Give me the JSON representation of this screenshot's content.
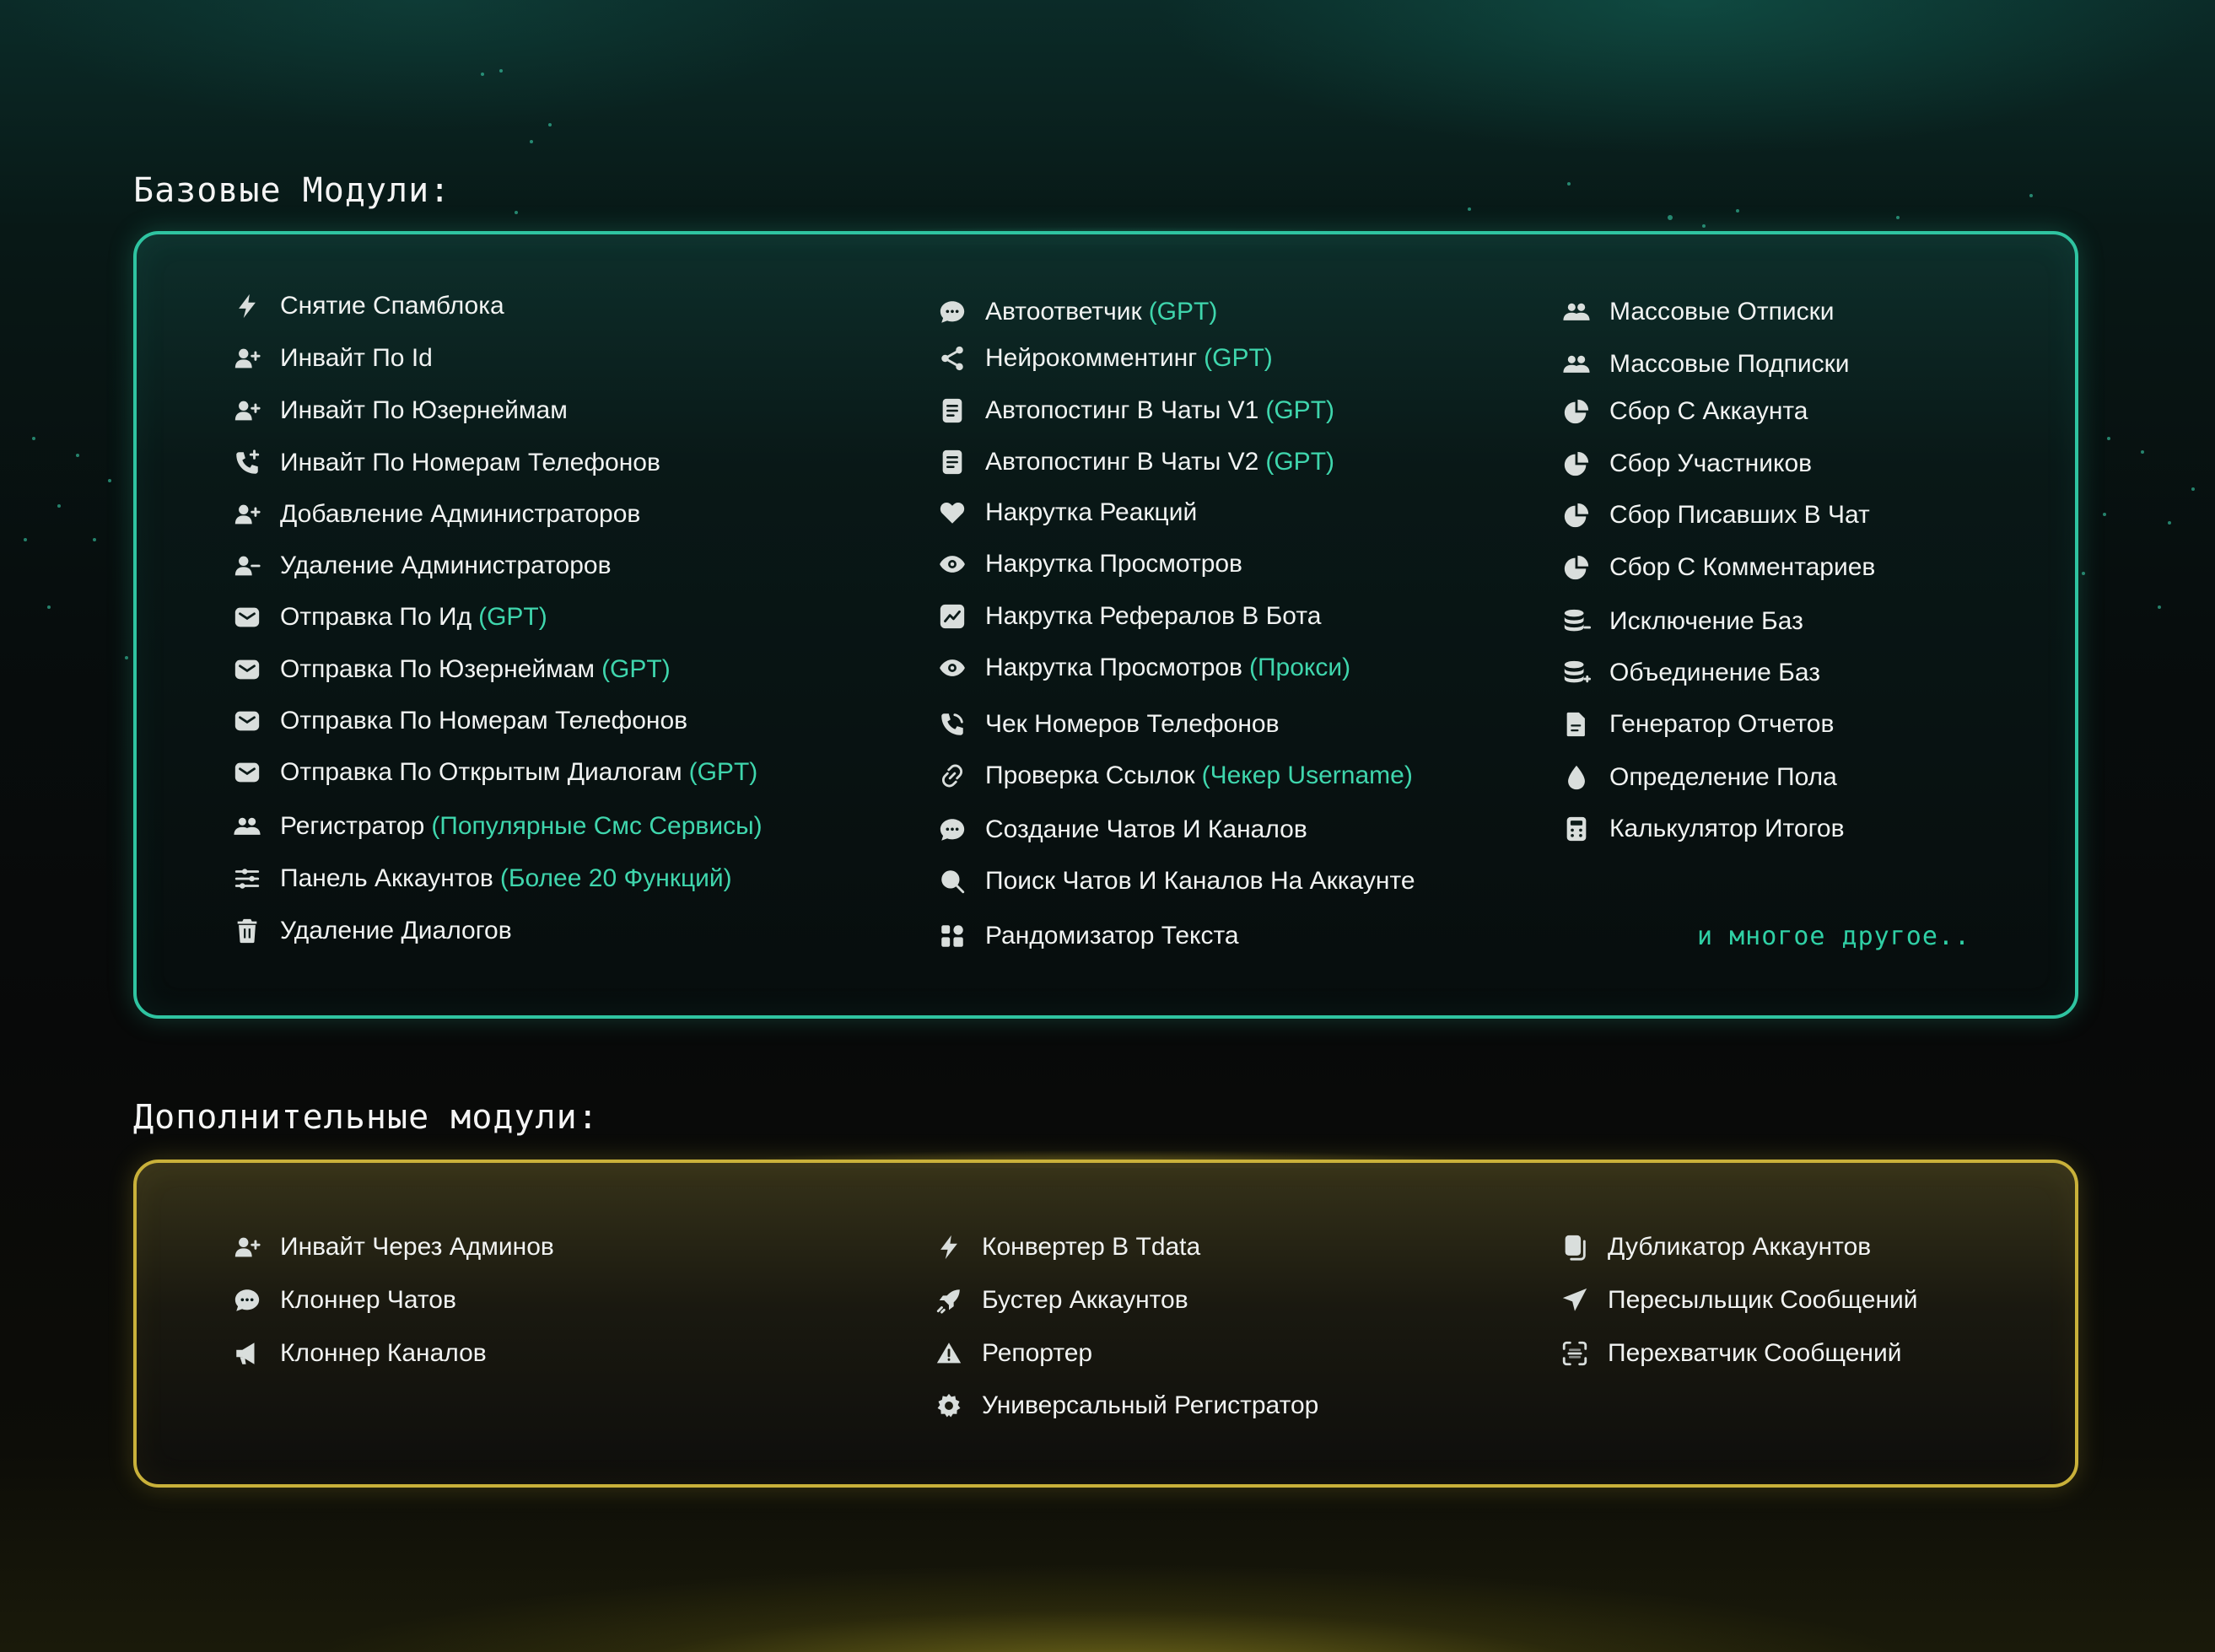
{
  "colors": {
    "accent_green": "#3fd6ad",
    "panel_green_border": "#2fc4a1",
    "panel_yellow_border": "#c9b13a",
    "text": "#f1f3f2",
    "icon": "#d9dedc"
  },
  "base": {
    "title": "Базовые Модули:",
    "more": "и многое другое..",
    "col1": [
      {
        "label": "Снятие Спамблока",
        "icon": "bolt-icon"
      },
      {
        "label": "Инвайт По Id",
        "icon": "user-plus-icon"
      },
      {
        "label": "Инвайт По Юзернеймам",
        "icon": "user-plus-icon"
      },
      {
        "label": "Инвайт По Номерам Телефонов",
        "icon": "phone-plus-icon"
      },
      {
        "label": "Добавление Администраторов",
        "icon": "user-plus-icon"
      },
      {
        "label": "Удаление Администраторов",
        "icon": "user-minus-icon"
      },
      {
        "label": "Отправка По Ид",
        "tag": "(GPT)",
        "icon": "mail-icon"
      },
      {
        "label": "Отправка По Юзернеймам",
        "tag": "(GPT)",
        "icon": "mail-icon"
      },
      {
        "label": "Отправка По Номерам Телефонов",
        "icon": "mail-icon"
      },
      {
        "label": "Отправка По Открытым Диалогам",
        "tag": "(GPT)",
        "icon": "mail-icon"
      },
      {
        "label": "Регистратор",
        "tag": "(Популярные Смс Сервисы)",
        "icon": "users-icon"
      },
      {
        "label": "Панель Аккаунтов",
        "tag": "(Более 20 Функций)",
        "icon": "sliders-icon"
      },
      {
        "label": "Удаление Диалогов",
        "icon": "trash-icon"
      }
    ],
    "col2": [
      {
        "label": "Автоответчик",
        "tag": "(GPT)",
        "icon": "chat-dots-icon"
      },
      {
        "label": "Нейрокомментинг",
        "tag": "(GPT)",
        "icon": "share-icon"
      },
      {
        "label": "Автопостинг В Чаты V1",
        "tag": "(GPT)",
        "icon": "document-icon"
      },
      {
        "label": "Автопостинг В Чаты V2",
        "tag": "(GPT)",
        "icon": "document-icon"
      },
      {
        "label": "Накрутка Реакций",
        "icon": "heart-icon"
      },
      {
        "label": "Накрутка Просмотров",
        "icon": "eye-icon"
      },
      {
        "label": "Накрутка Рефералов В Бота",
        "icon": "chart-icon"
      },
      {
        "label": "Накрутка Просмотров",
        "tag": "(Прокси)",
        "icon": "eye-icon"
      },
      {
        "label": "Чек Номеров Телефонов",
        "icon": "phone-icon"
      },
      {
        "label": "Проверка Ссылок",
        "tag": "(Чекер Username)",
        "icon": "link-icon"
      },
      {
        "label": "Создание Чатов И Каналов",
        "icon": "chat-dots-icon"
      },
      {
        "label": "Поиск Чатов И Каналов На Аккаунте",
        "icon": "search-icon"
      },
      {
        "label": "Рандомизатор Текста",
        "icon": "blocks-icon"
      }
    ],
    "col3": [
      {
        "label": "Массовые Отписки",
        "icon": "users-icon"
      },
      {
        "label": "Массовые Подписки",
        "icon": "users-icon"
      },
      {
        "label": "Сбор С Аккаунта",
        "icon": "pie-icon"
      },
      {
        "label": "Сбор Участников",
        "icon": "pie-icon"
      },
      {
        "label": "Сбор Писавших В Чат",
        "icon": "pie-icon"
      },
      {
        "label": "Сбор С Комментариев",
        "icon": "pie-icon"
      },
      {
        "label": "Исключение Баз",
        "icon": "database-minus-icon"
      },
      {
        "label": "Объединение Баз",
        "icon": "database-plus-icon"
      },
      {
        "label": "Генератор Отчетов",
        "icon": "file-icon"
      },
      {
        "label": "Определение Пола",
        "icon": "drop-icon"
      },
      {
        "label": "Калькулятор Итогов",
        "icon": "calculator-icon"
      }
    ]
  },
  "extra": {
    "title": "Дополнительные модули:",
    "col1": [
      {
        "label": "Инвайт Через Админов",
        "icon": "user-plus-icon"
      },
      {
        "label": "Клоннер Чатов",
        "icon": "chat-dots-icon"
      },
      {
        "label": "Клоннер Каналов",
        "icon": "megaphone-icon"
      }
    ],
    "col2": [
      {
        "label": "Конвертер В Tdata",
        "icon": "bolt-icon"
      },
      {
        "label": "Бустер Аккаунтов",
        "icon": "rocket-icon"
      },
      {
        "label": "Репортер",
        "icon": "warning-icon"
      },
      {
        "label": "Универсальный Регистратор",
        "icon": "gear-icon"
      }
    ],
    "col3": [
      {
        "label": "Дубликатор Аккаунтов",
        "icon": "copy-icon"
      },
      {
        "label": "Пересыльщик Сообщений",
        "icon": "send-icon"
      },
      {
        "label": "Перехватчик Сообщений",
        "icon": "scan-icon"
      }
    ]
  }
}
